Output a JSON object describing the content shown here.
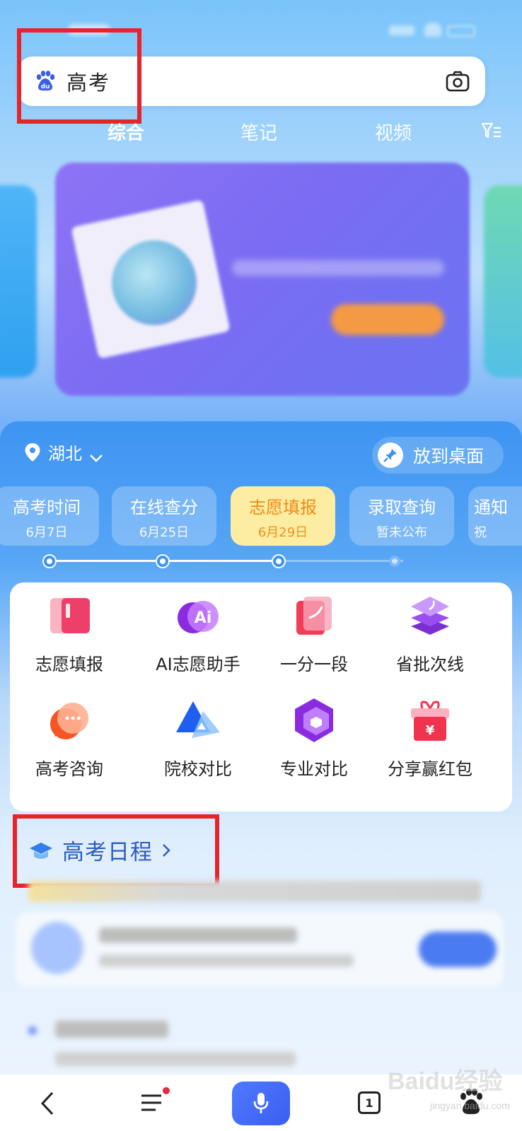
{
  "search": {
    "query": "高考"
  },
  "tabs": [
    "综合",
    "笔记",
    "视频"
  ],
  "panel": {
    "location": "湖北",
    "desktop_button": "放到桌面",
    "stages": [
      {
        "name": "高考时间",
        "date": "6月7日"
      },
      {
        "name": "在线查分",
        "date": "6月25日"
      },
      {
        "name": "志愿填报",
        "date": "6月29日"
      },
      {
        "name": "录取查询",
        "date": "暂未公布"
      },
      {
        "name": "通知",
        "date": "祝"
      }
    ],
    "tools": [
      "志愿填报",
      "AI志愿助手",
      "一分一段",
      "省批次线",
      "高考咨询",
      "院校对比",
      "专业对比",
      "分享赢红包"
    ],
    "schedule_title": "高考日程"
  },
  "bottom_nav": {
    "tab_count": "1"
  },
  "watermark": {
    "brand": "Baidu经验",
    "url": "jingyan.baidu.com"
  },
  "colors": {
    "accent_blue": "#3d94f2",
    "highlight_red": "#e8242b",
    "active_stage": "#fdeda3"
  }
}
